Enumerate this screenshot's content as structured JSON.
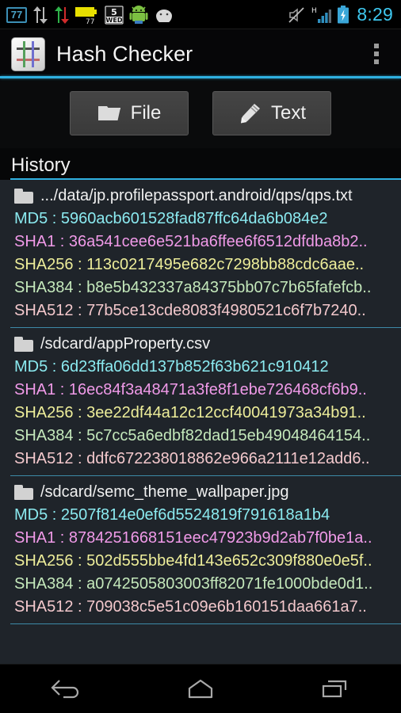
{
  "statusbar": {
    "icons": [
      {
        "name": "network-speed-badge",
        "value": "77"
      },
      {
        "name": "data-transfer-icon",
        "value": ""
      },
      {
        "name": "data-updown-arrows-icon",
        "value": ""
      },
      {
        "name": "battery-percent-widget-icon",
        "value": "77"
      },
      {
        "name": "calendar-date-icon",
        "value": "5"
      },
      {
        "name": "calendar-day-icon",
        "value": "WED"
      },
      {
        "name": "android-robot-icon",
        "value": ""
      },
      {
        "name": "android-face-icon",
        "value": ""
      }
    ],
    "right": {
      "mute_icon": "mute-icon",
      "signal_type": "H",
      "signal_icon": "signal-bars-icon",
      "battery_icon": "battery-charging-icon",
      "clock": "8:29"
    }
  },
  "actionbar": {
    "app_icon": "hash-app-icon",
    "title": "Hash Checker",
    "overflow": "overflow-menu-icon"
  },
  "buttons": [
    {
      "icon": "folder-icon",
      "label": "File"
    },
    {
      "icon": "pencil-icon",
      "label": "Text"
    }
  ],
  "history": {
    "title": "History",
    "items": [
      {
        "file": ".../data/jp.profilepassport.android/qps/qps.txt",
        "hashes": [
          {
            "label": "MD5 : ",
            "value": "5960acb601528fad87ffc64da6b084e2",
            "cls": "h-md5"
          },
          {
            "label": "SHA1 : ",
            "value": "36a541cee6e521ba6ffee6f6512dfdba8b2..",
            "cls": "h-sha1"
          },
          {
            "label": "SHA256 : ",
            "value": "113c0217495e682c7298bb88cdc6aae..",
            "cls": "h-sha256"
          },
          {
            "label": "SHA384 : ",
            "value": "b8e5b432337a84375bb07c7b65fafefcb..",
            "cls": "h-sha384"
          },
          {
            "label": "SHA512 : ",
            "value": "77b5ce13cde8083f4980521c6f7b7240..",
            "cls": "h-sha512"
          }
        ]
      },
      {
        "file": "/sdcard/appProperty.csv",
        "hashes": [
          {
            "label": "MD5 : ",
            "value": "6d23ffa06dd137b852f63b621c910412",
            "cls": "h-md5"
          },
          {
            "label": "SHA1 : ",
            "value": "16ec84f3a48471a3fe8f1ebe726468cf6b9..",
            "cls": "h-sha1"
          },
          {
            "label": "SHA256 : ",
            "value": "3ee22df44a12c12ccf40041973a34b91..",
            "cls": "h-sha256"
          },
          {
            "label": "SHA384 : ",
            "value": "5c7cc5a6edbf82dad15eb49048464154..",
            "cls": "h-sha384"
          },
          {
            "label": "SHA512 : ",
            "value": "ddfc672238018862e966a2111e12add6..",
            "cls": "h-sha512"
          }
        ]
      },
      {
        "file": "/sdcard/semc_theme_wallpaper.jpg",
        "hashes": [
          {
            "label": "MD5 : ",
            "value": "2507f814e0ef6d5524819f791618a1b4",
            "cls": "h-md5"
          },
          {
            "label": "SHA1 : ",
            "value": "8784251668151eec47923b9d2ab7f0be1a..",
            "cls": "h-sha1"
          },
          {
            "label": "SHA256 : ",
            "value": "502d555bbe4fd143e652c309f880e0e5f..",
            "cls": "h-sha256"
          },
          {
            "label": "SHA384 : ",
            "value": "a0742505803003ff82071fe1000bde0d1..",
            "cls": "h-sha384"
          },
          {
            "label": "SHA512 : ",
            "value": "709038c5e51c09e6b160151daa661a7..",
            "cls": "h-sha512"
          }
        ]
      }
    ]
  },
  "navbar": {
    "back": "back-icon",
    "home": "home-icon",
    "recents": "recents-icon"
  },
  "colors": {
    "accent": "#2fb0e0",
    "divider": "#3d8aa8",
    "list_bg": "#1f242a",
    "clock": "#3ec8f0"
  }
}
